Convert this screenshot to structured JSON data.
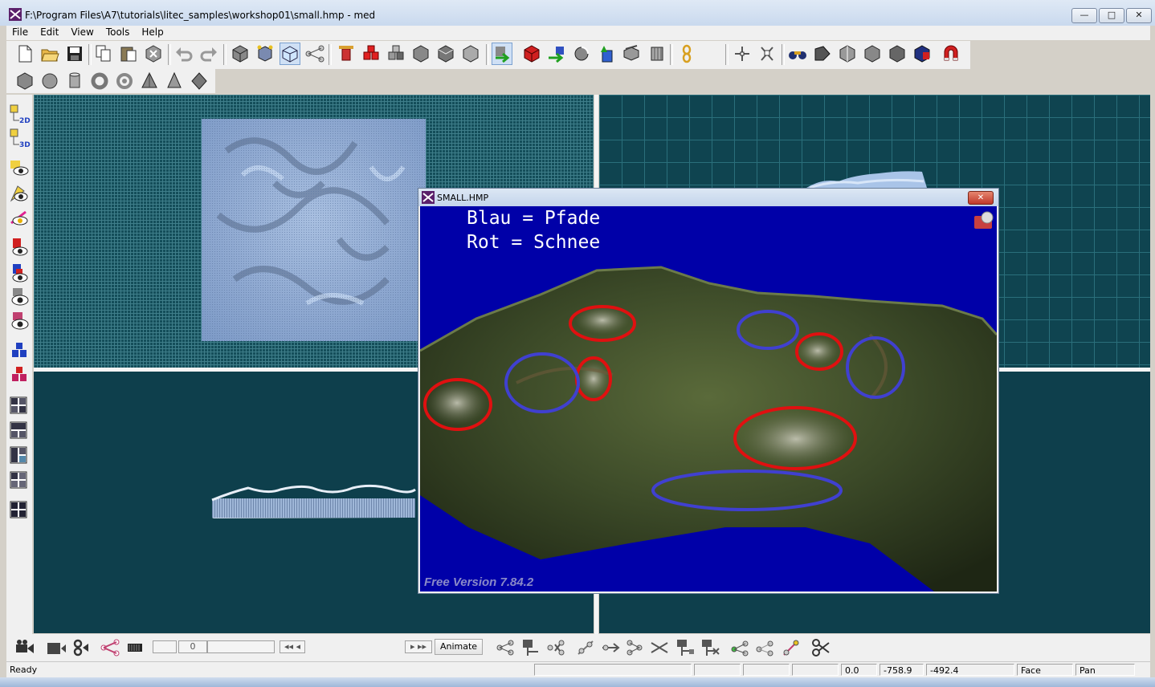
{
  "window": {
    "title": "F:\\Program Files\\A7\\tutorials\\litec_samples\\workshop01\\small.hmp - med",
    "minimize": "—",
    "maximize": "□",
    "close": "✕"
  },
  "menu": [
    "File",
    "Edit",
    "View",
    "Tools",
    "Help"
  ],
  "hmp_window": {
    "title": "SMALL.HMP",
    "close": "✕",
    "caption_line1": "Blau = Pfade",
    "caption_line2": "Rot = Schnee",
    "version": "Free Version 7.84.2"
  },
  "bottom": {
    "frame_value": "0",
    "animate_label": "Animate"
  },
  "status": {
    "ready": "Ready",
    "x": "0.0",
    "y": "-758.9",
    "z": "-492.4",
    "mode": "Face",
    "tool": "Pan"
  },
  "colors": {
    "accent_red": "#e01010",
    "accent_blue": "#4040d0",
    "render_bg": "#0000a8",
    "viewport_bg": "#0e3f4c"
  }
}
